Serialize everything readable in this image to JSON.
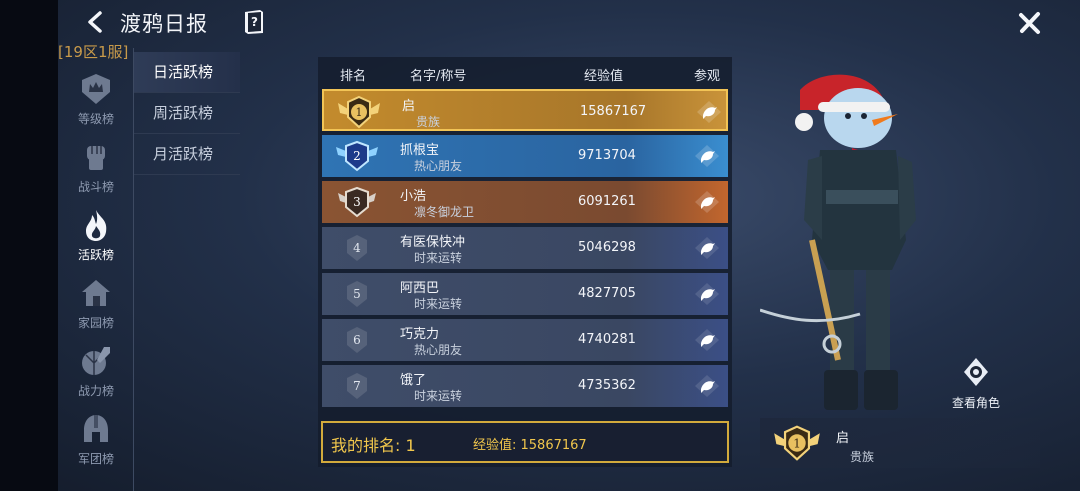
{
  "header": {
    "title": "渡鸦日报",
    "server": "[19区1服]"
  },
  "rail": {
    "items": [
      {
        "label": "等级榜",
        "icon": "crown-shield-icon",
        "active": false
      },
      {
        "label": "战斗榜",
        "icon": "fist-icon",
        "active": false
      },
      {
        "label": "活跃榜",
        "icon": "flame-icon",
        "active": true
      },
      {
        "label": "家园榜",
        "icon": "house-icon",
        "active": false
      },
      {
        "label": "战力榜",
        "icon": "shield-sword-icon",
        "active": false
      },
      {
        "label": "军团榜",
        "icon": "helmet-icon",
        "active": false
      }
    ]
  },
  "subtabs": [
    {
      "label": "日活跃榜",
      "active": true
    },
    {
      "label": "周活跃榜",
      "active": false
    },
    {
      "label": "月活跃榜",
      "active": false
    }
  ],
  "table": {
    "headers": {
      "rank": "排名",
      "name": "名字/称号",
      "xp": "经验值",
      "view": "参观"
    },
    "rows": [
      {
        "rank": "1",
        "name": "启",
        "title": "贵族",
        "xp": "15867167"
      },
      {
        "rank": "2",
        "name": "抓根宝",
        "title": "热心朋友",
        "xp": "9713704"
      },
      {
        "rank": "3",
        "name": "小浩",
        "title": "凛冬御龙卫",
        "xp": "6091261"
      },
      {
        "rank": "4",
        "name": "有医保快冲",
        "title": "时来运转",
        "xp": "5046298"
      },
      {
        "rank": "5",
        "name": "阿西巴",
        "title": "时来运转",
        "xp": "4827705"
      },
      {
        "rank": "6",
        "name": "巧克力",
        "title": "热心朋友",
        "xp": "4740281"
      },
      {
        "rank": "7",
        "name": "饿了",
        "title": "时来运转",
        "xp": "4735362"
      }
    ]
  },
  "my_rank": {
    "label": "我的排名: 1",
    "xp_label": "经验值: 15867167"
  },
  "character": {
    "view_label": "查看角色",
    "rank": "1",
    "name": "启",
    "title": "贵族"
  },
  "colors": {
    "gold": "#f0c64c",
    "rank1_row": "#c38b2d",
    "rank2_row": "#2f74b4",
    "rank3_row": "#8a5433",
    "plain_row": "#3f4d69"
  }
}
